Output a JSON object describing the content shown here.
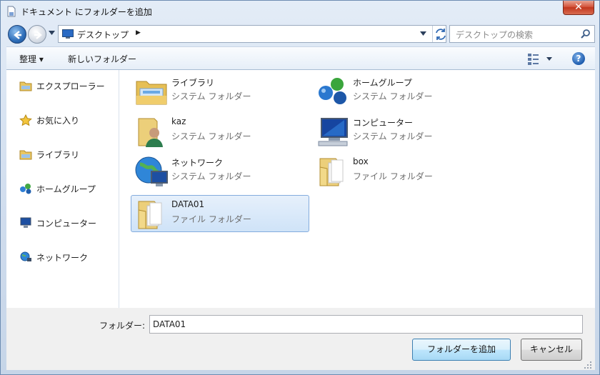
{
  "window": {
    "title": "ドキュメント にフォルダーを追加",
    "close_label": "✕"
  },
  "navbar": {
    "address": "デスクトップ",
    "search_placeholder": "デスクトップの検索"
  },
  "toolbar": {
    "organize_label": "整理 ▾",
    "new_folder_label": "新しいフォルダー",
    "help_label": "?"
  },
  "sidebar": {
    "items": [
      {
        "label": "エクスプローラー",
        "icon": "library-folder-icon"
      },
      {
        "label": "お気に入り",
        "icon": "star-icon"
      },
      {
        "label": "ライブラリ",
        "icon": "library-icon"
      },
      {
        "label": "ホームグループ",
        "icon": "homegroup-icon"
      },
      {
        "label": "コンピューター",
        "icon": "computer-icon"
      },
      {
        "label": "ネットワーク",
        "icon": "network-icon"
      }
    ]
  },
  "files": [
    {
      "name": "ライブラリ",
      "type": "システム フォルダー",
      "icon": "library-folder-icon",
      "selected": false
    },
    {
      "name": "ホームグループ",
      "type": "システム フォルダー",
      "icon": "homegroup-icon",
      "selected": false
    },
    {
      "name": "kaz",
      "type": "システム フォルダー",
      "icon": "user-folder-icon",
      "selected": false
    },
    {
      "name": "コンピューター",
      "type": "システム フォルダー",
      "icon": "computer-icon",
      "selected": false
    },
    {
      "name": "ネットワーク",
      "type": "システム フォルダー",
      "icon": "network-icon",
      "selected": false
    },
    {
      "name": "box",
      "type": "ファイル フォルダー",
      "icon": "folder-icon",
      "selected": false
    },
    {
      "name": "DATA01",
      "type": "ファイル フォルダー",
      "icon": "folder-icon",
      "selected": true
    }
  ],
  "bottom": {
    "folder_label": "フォルダー:",
    "folder_value": "DATA01",
    "add_button": "フォルダーを追加",
    "cancel_button": "キャンセル"
  },
  "colors": {
    "selection_fill": "#cfe3f8",
    "selection_border": "#84acdd",
    "close_button": "#c2371e"
  }
}
